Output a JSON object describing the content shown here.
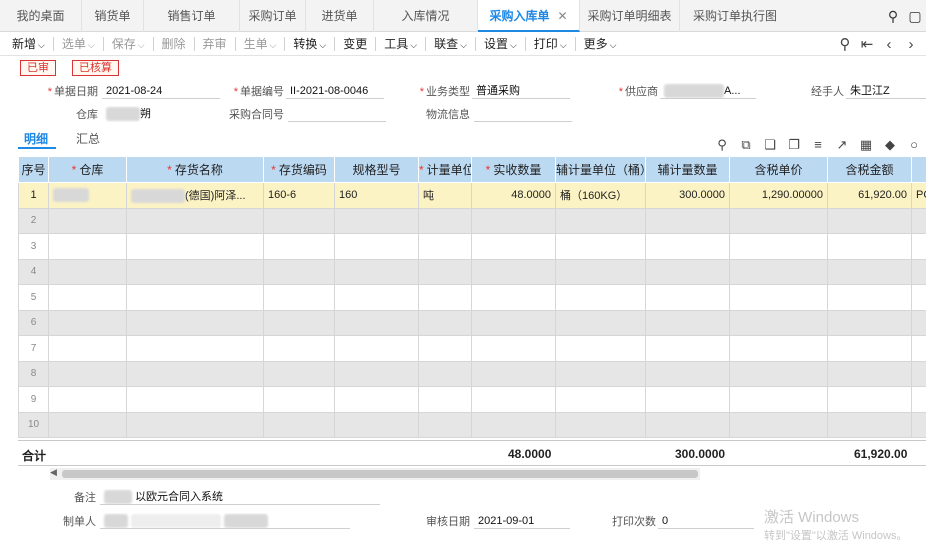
{
  "tabs": [
    {
      "label": "我的桌面"
    },
    {
      "label": "销货单"
    },
    {
      "label": "销售订单"
    },
    {
      "label": "采购订单"
    },
    {
      "label": "进货单"
    },
    {
      "label": "入库情况"
    },
    {
      "label": "采购入库单",
      "active": true
    },
    {
      "label": "采购订单明细表"
    },
    {
      "label": "采购订单执行图"
    }
  ],
  "toolbar": {
    "items": [
      "新增",
      "选单",
      "保存",
      "删除",
      "弃审",
      "生单",
      "转换",
      "变更",
      "工具",
      "联查",
      "设置",
      "打印",
      "更多"
    ]
  },
  "status": {
    "audited": "已审",
    "checked": "已核算"
  },
  "form": {
    "date_label": "单据日期",
    "date_value": "2021-08-24",
    "code_label": "单据编号",
    "code_value": "II-2021-08-0046",
    "biztype_label": "业务类型",
    "biztype_value": "普通采购",
    "supplier_label": "供应商",
    "supplier_value": "A...",
    "handler_label": "经手人",
    "handler_value": "朱卫江Z",
    "warehouse_label": "仓库",
    "warehouse_value": "朔",
    "contract_label": "采购合同号",
    "contract_value": "",
    "logistics_label": "物流信息",
    "logistics_value": ""
  },
  "subtabs": {
    "detail": "明细",
    "summary": "汇总"
  },
  "grid": {
    "headers": [
      "序号",
      "仓库",
      "存货名称",
      "存货编码",
      "规格型号",
      "计量单位",
      "实收数量",
      "辅计量单位（桶）",
      "辅计量数量",
      "含税单价",
      "含税金额",
      ""
    ],
    "row1": {
      "index": "1",
      "warehouse": "",
      "name": "(德国)阿泽...",
      "code": "160-6",
      "spec": "160",
      "unit": "吨",
      "qty": "48.0000",
      "aux_unit": "桶（160KG）",
      "aux_qty": "300.0000",
      "price": "1,290.00000",
      "amount": "61,920.00",
      "extra": "PC"
    },
    "empty_rows": [
      "2",
      "3",
      "4",
      "5",
      "6",
      "7",
      "8",
      "9",
      "10"
    ]
  },
  "totals": {
    "label": "合计",
    "qty": "48.0000",
    "aux_qty": "300.0000",
    "amount": "61,920.00"
  },
  "footer": {
    "remark_label": "备注",
    "remark_value": "以欧元合同入系统",
    "maker_label": "制单人",
    "audit_date_label": "审核日期",
    "audit_date_value": "2021-09-01",
    "print_count_label": "打印次数",
    "print_count_value": "0"
  },
  "watermark": {
    "line1": "激活 Windows",
    "line2": "转到\"设置\"以激活 Windows。"
  }
}
